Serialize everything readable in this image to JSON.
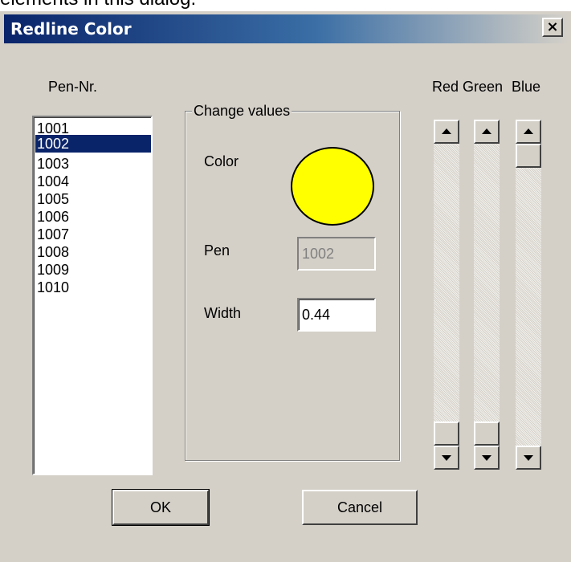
{
  "caption": "elements in this dialog.",
  "dialog": {
    "title": "Redline Color",
    "close_label": "×"
  },
  "pen_list": {
    "label": "Pen-Nr.",
    "items": [
      "1001",
      "1002",
      "1003",
      "1004",
      "1005",
      "1006",
      "1007",
      "1008",
      "1009",
      "1010"
    ],
    "selected": "1002"
  },
  "change_values": {
    "legend": "Change values",
    "color_label": "Color",
    "color_value": "#ffff00",
    "pen_label": "Pen",
    "pen_value": "1002",
    "width_label": "Width",
    "width_value": "0.44"
  },
  "sliders": {
    "red_label": "Red",
    "green_label": "Green",
    "blue_label": "Blue",
    "red_level": 1.0,
    "green_level": 1.0,
    "blue_level": 0.0
  },
  "buttons": {
    "ok_label": "OK",
    "cancel_label": "Cancel"
  }
}
